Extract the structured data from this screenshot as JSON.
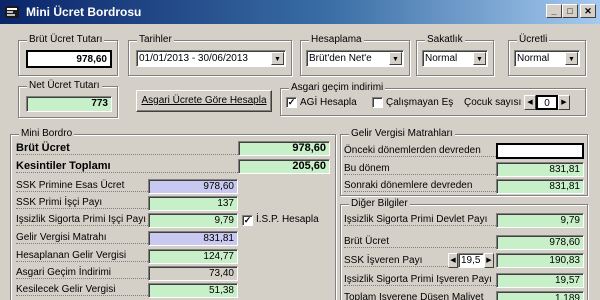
{
  "window": {
    "title": "Mini Ücret Bordrosu"
  },
  "top": {
    "brut_ucret_label": "Brüt Ücret Tutarı",
    "brut_ucret_value": "978,60",
    "tarihler_label": "Tarihler",
    "tarihler_value": "01/01/2013 - 30/06/2013",
    "hesaplama_label": "Hesaplama",
    "hesaplama_value": "Brüt'den Net'e",
    "sakatlik_label": "Sakatlık",
    "sakatlik_value": "Normal",
    "ucretli_label": "Ücretli",
    "ucretli_value": "Normal",
    "net_ucret_label": "Net Ücret Tutarı",
    "net_ucret_value": "773",
    "agi_button": "Asgari Ücrete Göre Hesapla",
    "agi_group_label": "Asgari geçim indirimi",
    "agi_hesapla_label": "AGİ Hesapla",
    "agi_hesapla_checked": true,
    "calismayan_es_label": "Çalışmayan Eş",
    "calismayan_es_checked": false,
    "cocuk_label": "Çocuk sayısı",
    "cocuk_value": "0"
  },
  "mini_bordro": {
    "label": "Mini Bordro",
    "brut_ucret_label": "Brüt Ücret",
    "brut_ucret_value": "978,60",
    "kesintiler_label": "Kesintiler Toplamı",
    "kesintiler_value": "205,60",
    "rows": [
      {
        "label": "SSK Primine Esas Ücret",
        "value": "978,60"
      },
      {
        "label": "SSK Primi İşçi Payı",
        "value": "137"
      },
      {
        "label": "İşsizlik Sigorta Primi İşçi Payı",
        "value": "9,79"
      },
      {
        "label": "Gelir Vergisi Matrahı",
        "value": "831,81"
      },
      {
        "label": "Hesaplanan Gelir Vergisi",
        "value": "124,77"
      },
      {
        "label": "Asgari Geçim İndirimi",
        "value": "73,40"
      },
      {
        "label": "Kesilecek Gelir Vergisi",
        "value": "51,38"
      }
    ],
    "isp_label": "İ.S.P. Hesapla",
    "isp_checked": true
  },
  "gelir_vergisi": {
    "label": "Gelir Vergisi Matrahları",
    "rows": [
      {
        "label": "Önceki dönemlerden devreden",
        "value": ""
      },
      {
        "label": "Bu dönem",
        "value": "831,81"
      },
      {
        "label": "Sonraki dönemlere devreden",
        "value": "831,81"
      }
    ]
  },
  "diger_bilgiler": {
    "label": "Diğer Bilgiler",
    "rows": [
      {
        "label": "İşsizlik Sigorta Primi Devlet Payı",
        "value": "9,79"
      },
      {
        "label": "Brüt Ücret",
        "value": "978,60"
      },
      {
        "label": "SSK İşveren Payı",
        "value": "190,83"
      },
      {
        "label": "İşsizlik Sigorta Primi İşveren Payı",
        "value": "19,57"
      },
      {
        "label": "Toplam İşverene Düşen Maliyet",
        "value": "1.189"
      }
    ],
    "ssk_isveren_rate": "19,5"
  }
}
